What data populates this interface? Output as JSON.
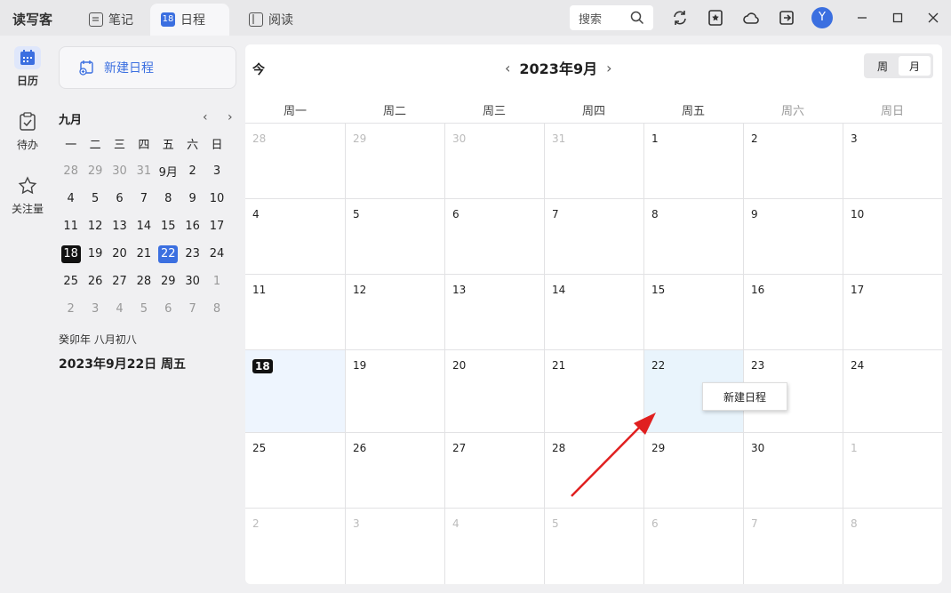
{
  "app_name": "读写客",
  "tabs": [
    {
      "label": "笔记",
      "icon": "note-icon"
    },
    {
      "label": "日程",
      "icon": "calendar-icon",
      "badge": "18"
    },
    {
      "label": "阅读",
      "icon": "book-icon"
    }
  ],
  "search": {
    "placeholder": "搜索"
  },
  "user": {
    "avatar_letter": "Y"
  },
  "rail": [
    {
      "label": "日历",
      "icon": "calendar-icon"
    },
    {
      "label": "待办",
      "icon": "todo-icon"
    },
    {
      "label": "关注量",
      "icon": "star-icon"
    }
  ],
  "sidebar": {
    "new_event_label": "新建日程",
    "mini_month": "九月",
    "weekdays": [
      "一",
      "二",
      "三",
      "四",
      "五",
      "六",
      "日"
    ],
    "days": [
      [
        "28",
        "29",
        "30",
        "31",
        "9月",
        "2",
        "3"
      ],
      [
        "4",
        "5",
        "6",
        "7",
        "8",
        "9",
        "10"
      ],
      [
        "11",
        "12",
        "13",
        "14",
        "15",
        "16",
        "17"
      ],
      [
        "18",
        "19",
        "20",
        "21",
        "22",
        "23",
        "24"
      ],
      [
        "25",
        "26",
        "27",
        "28",
        "29",
        "30",
        "1"
      ],
      [
        "2",
        "3",
        "4",
        "5",
        "6",
        "7",
        "8"
      ]
    ],
    "lunar": "癸卯年 八月初八",
    "full_date": "2023年9月22日 周五"
  },
  "main": {
    "today_label": "今",
    "month_title": "2023年9月",
    "views": [
      "周",
      "月"
    ],
    "active_view": "月",
    "weekdays": [
      "周一",
      "周二",
      "周三",
      "周四",
      "周五",
      "周六",
      "周日"
    ],
    "days": [
      [
        "28",
        "29",
        "30",
        "31",
        "1",
        "2",
        "3"
      ],
      [
        "4",
        "5",
        "6",
        "7",
        "8",
        "9",
        "10"
      ],
      [
        "11",
        "12",
        "13",
        "14",
        "15",
        "16",
        "17"
      ],
      [
        "18",
        "19",
        "20",
        "21",
        "22",
        "23",
        "24"
      ],
      [
        "25",
        "26",
        "27",
        "28",
        "29",
        "30",
        "1"
      ],
      [
        "2",
        "3",
        "4",
        "5",
        "6",
        "7",
        "8"
      ]
    ],
    "context_menu_item": "新建日程"
  },
  "colors": {
    "accent": "#3b6fe0",
    "today_badge": "#111111",
    "arrow": "#e02020"
  }
}
